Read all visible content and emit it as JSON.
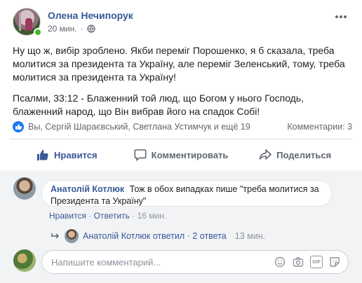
{
  "post": {
    "author": "Олена Нечипорук",
    "time": "20 мин.",
    "separator": "·",
    "paragraphs": [
      "Ну що ж, вибір зроблено. Якби переміг Порошенко, я б сказала, треба молитися за президента та Україну, але переміг Зеленський, тому, треба молитися за президента та Україну!",
      "Псалми, 33:12 - Блаженний той люд, що Богом у нього Господь, блаженний народ, що Він вибрав його на спадок Собі!"
    ]
  },
  "reactions": {
    "reactors": "Вы, Сергій Шараєвський, Светлана Устимчук и ещё 19",
    "comments_count": "Комментарии: 3"
  },
  "actions": {
    "like": "Нравится",
    "comment": "Комментировать",
    "share": "Поделиться"
  },
  "comment": {
    "author": "Анатолій Котлюк",
    "text": "Тож в обох випадках пише \"треба молитися за Президента та Україну\"",
    "like_link": "Нравится",
    "reply_link": "Ответить",
    "time": "16 мин.",
    "dot": "·"
  },
  "reply_summary": {
    "author": "Анатолій Котлюк",
    "action": "ответил",
    "dot": "·",
    "count": "2 ответа",
    "time": "13 мин."
  },
  "composer": {
    "placeholder": "Напишите комментарий..."
  },
  "colors": {
    "link_blue": "#385898",
    "like_blue": "#1877f2",
    "online_green": "#42b72a",
    "comments_bg": "#f2f3f5"
  },
  "icons": [
    "globe-icon",
    "more-options-icon",
    "like-badge-icon",
    "thumbs-up-icon",
    "comment-icon",
    "share-icon",
    "reply-arrow-icon",
    "emoji-icon",
    "camera-icon",
    "gif-icon",
    "sticker-icon"
  ]
}
